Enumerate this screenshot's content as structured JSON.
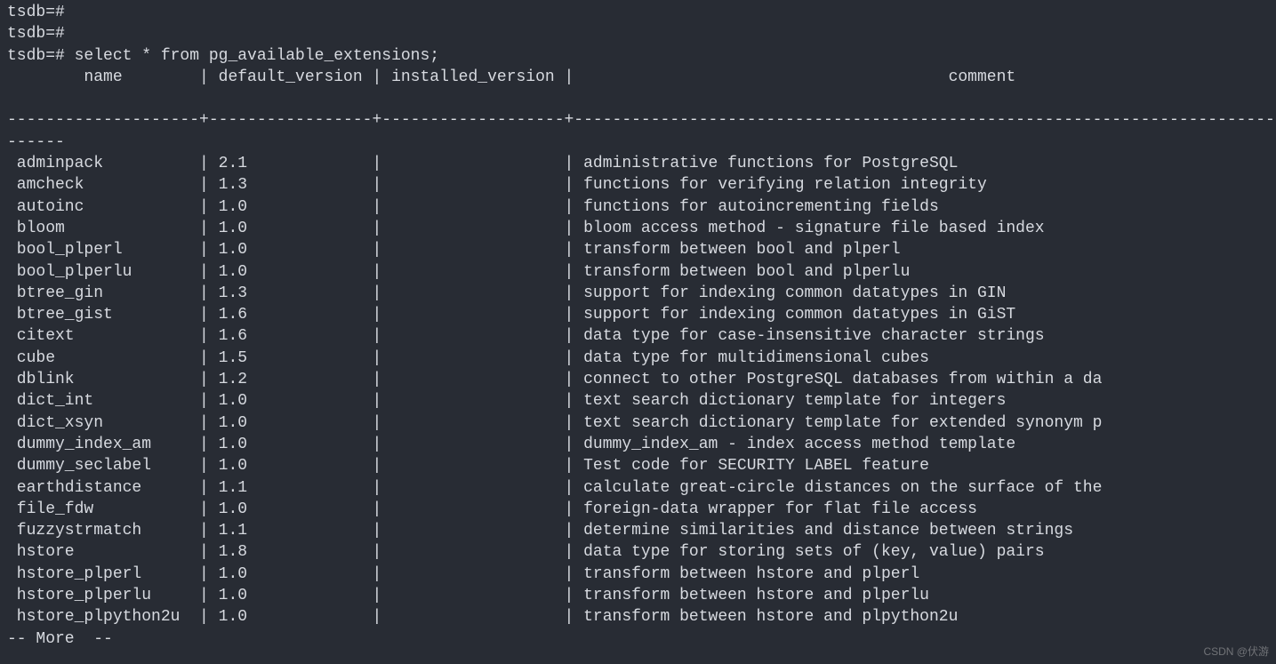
{
  "prompt_lines": [
    "tsdb=#",
    "tsdb=#",
    "tsdb=# select * from pg_available_extensions;"
  ],
  "columns": {
    "name": "name",
    "default_version": "default_version",
    "installed_version": "installed_version",
    "comment": "comment"
  },
  "chart_data": {
    "type": "table",
    "columns": [
      "name",
      "default_version",
      "installed_version",
      "comment"
    ],
    "rows": [
      {
        "name": "adminpack",
        "default_version": "2.1",
        "installed_version": "",
        "comment": "administrative functions for PostgreSQL"
      },
      {
        "name": "amcheck",
        "default_version": "1.3",
        "installed_version": "",
        "comment": "functions for verifying relation integrity"
      },
      {
        "name": "autoinc",
        "default_version": "1.0",
        "installed_version": "",
        "comment": "functions for autoincrementing fields"
      },
      {
        "name": "bloom",
        "default_version": "1.0",
        "installed_version": "",
        "comment": "bloom access method - signature file based index"
      },
      {
        "name": "bool_plperl",
        "default_version": "1.0",
        "installed_version": "",
        "comment": "transform between bool and plperl"
      },
      {
        "name": "bool_plperlu",
        "default_version": "1.0",
        "installed_version": "",
        "comment": "transform between bool and plperlu"
      },
      {
        "name": "btree_gin",
        "default_version": "1.3",
        "installed_version": "",
        "comment": "support for indexing common datatypes in GIN"
      },
      {
        "name": "btree_gist",
        "default_version": "1.6",
        "installed_version": "",
        "comment": "support for indexing common datatypes in GiST"
      },
      {
        "name": "citext",
        "default_version": "1.6",
        "installed_version": "",
        "comment": "data type for case-insensitive character strings"
      },
      {
        "name": "cube",
        "default_version": "1.5",
        "installed_version": "",
        "comment": "data type for multidimensional cubes"
      },
      {
        "name": "dblink",
        "default_version": "1.2",
        "installed_version": "",
        "comment": "connect to other PostgreSQL databases from within a da"
      },
      {
        "name": "dict_int",
        "default_version": "1.0",
        "installed_version": "",
        "comment": "text search dictionary template for integers"
      },
      {
        "name": "dict_xsyn",
        "default_version": "1.0",
        "installed_version": "",
        "comment": "text search dictionary template for extended synonym p"
      },
      {
        "name": "dummy_index_am",
        "default_version": "1.0",
        "installed_version": "",
        "comment": "dummy_index_am - index access method template"
      },
      {
        "name": "dummy_seclabel",
        "default_version": "1.0",
        "installed_version": "",
        "comment": "Test code for SECURITY LABEL feature"
      },
      {
        "name": "earthdistance",
        "default_version": "1.1",
        "installed_version": "",
        "comment": "calculate great-circle distances on the surface of the"
      },
      {
        "name": "file_fdw",
        "default_version": "1.0",
        "installed_version": "",
        "comment": "foreign-data wrapper for flat file access"
      },
      {
        "name": "fuzzystrmatch",
        "default_version": "1.1",
        "installed_version": "",
        "comment": "determine similarities and distance between strings"
      },
      {
        "name": "hstore",
        "default_version": "1.8",
        "installed_version": "",
        "comment": "data type for storing sets of (key, value) pairs"
      },
      {
        "name": "hstore_plperl",
        "default_version": "1.0",
        "installed_version": "",
        "comment": "transform between hstore and plperl"
      },
      {
        "name": "hstore_plperlu",
        "default_version": "1.0",
        "installed_version": "",
        "comment": "transform between hstore and plperlu"
      },
      {
        "name": "hstore_plpython2u",
        "default_version": "1.0",
        "installed_version": "",
        "comment": "transform between hstore and plpython2u"
      }
    ]
  },
  "pager": "-- More  --",
  "watermark": "CSDN @伏游"
}
